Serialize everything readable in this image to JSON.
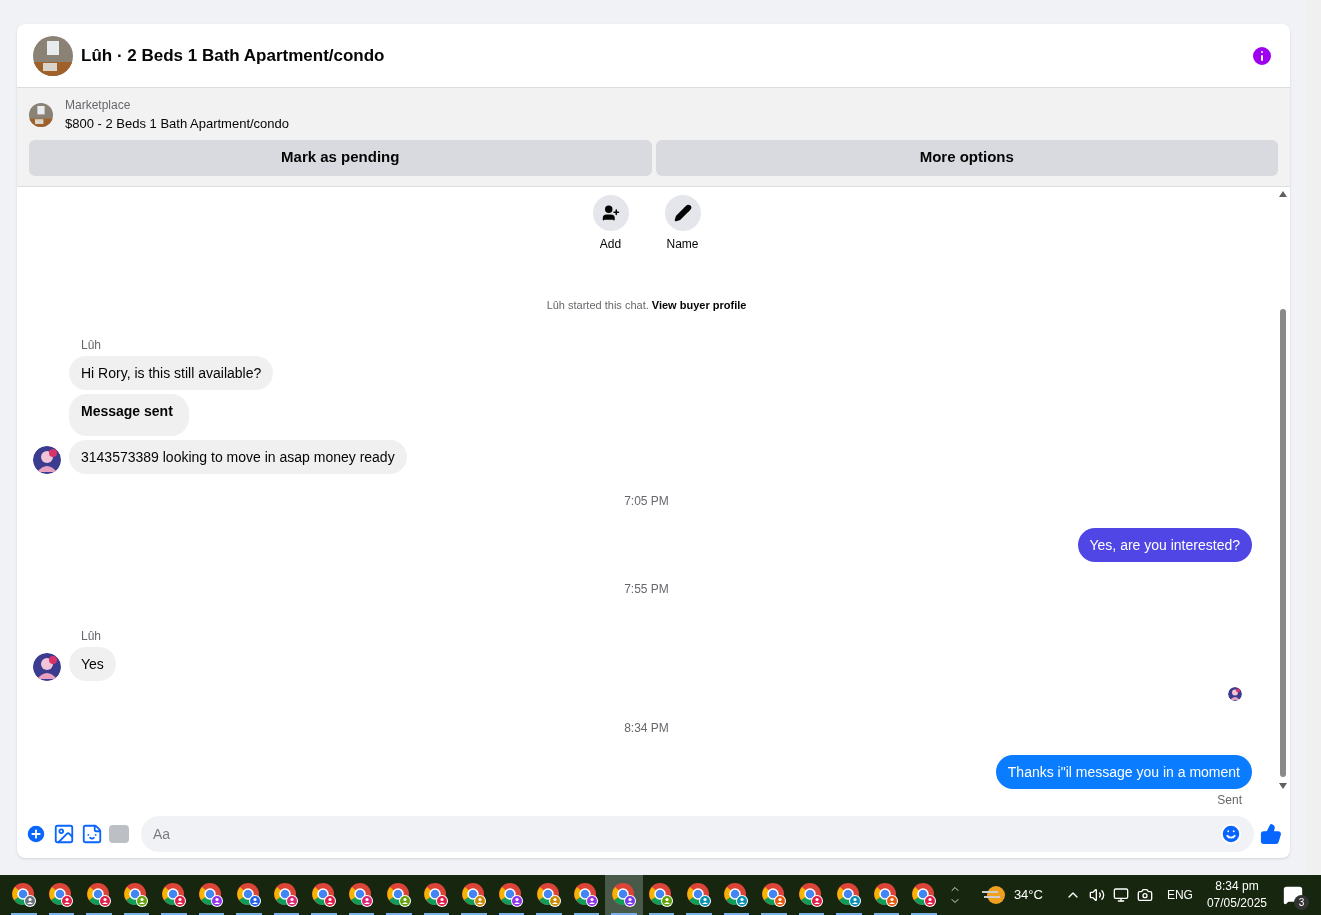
{
  "header": {
    "title": "Lûh · 2 Beds 1 Bath Apartment/condo"
  },
  "listing": {
    "source": "Marketplace",
    "title": "$800 - 2 Beds 1 Bath Apartment/condo",
    "buttons": [
      "Mark as pending",
      "More options"
    ]
  },
  "actions": [
    {
      "kind": "add",
      "label": "Add"
    },
    {
      "kind": "name",
      "label": "Name"
    }
  ],
  "system_note": {
    "text": "Lûh started this chat.",
    "link": "View buyer profile"
  },
  "messages": [
    {
      "kind": "sender",
      "text": "Lûh"
    },
    {
      "kind": "incoming",
      "text": "Hi Rory, is this still available?",
      "avatar": false,
      "bold": false
    },
    {
      "kind": "incoming",
      "text": "Message sent",
      "avatar": false,
      "bold": true
    },
    {
      "kind": "incoming",
      "text": "3143573389 looking to move in asap money ready",
      "avatar": true,
      "bold": false
    },
    {
      "kind": "time",
      "text": "7:05 PM"
    },
    {
      "kind": "outgoing",
      "text": "Yes, are you interested?",
      "color": "#4f46e5"
    },
    {
      "kind": "time",
      "text": "7:55 PM"
    },
    {
      "kind": "sender",
      "text": "Lûh"
    },
    {
      "kind": "incoming",
      "text": "Yes",
      "avatar": true,
      "bold": false
    },
    {
      "kind": "seen"
    },
    {
      "kind": "time",
      "text": "8:34 PM"
    },
    {
      "kind": "outgoing",
      "text": "Thanks i\"il message you in a moment",
      "color": "#0a7cff"
    },
    {
      "kind": "status",
      "text": "Sent"
    }
  ],
  "composer": {
    "placeholder": "Aa"
  },
  "taskbar": {
    "apps": [
      {
        "color": "#6b7280",
        "selected": false
      },
      {
        "color": "#e11d48",
        "selected": false
      },
      {
        "color": "#e11d48",
        "selected": false
      },
      {
        "color": "#65a30d",
        "selected": false
      },
      {
        "color": "#e11d48",
        "selected": false
      },
      {
        "color": "#9333ea",
        "selected": false
      },
      {
        "color": "#2563eb",
        "selected": false
      },
      {
        "color": "#db2777",
        "selected": false
      },
      {
        "color": "#e11d48",
        "selected": false
      },
      {
        "color": "#db2777",
        "selected": false
      },
      {
        "color": "#65a30d",
        "selected": false
      },
      {
        "color": "#e11d48",
        "selected": false
      },
      {
        "color": "#ca8a04",
        "selected": false
      },
      {
        "color": "#9333ea",
        "selected": false
      },
      {
        "color": "#ca8a04",
        "selected": false
      },
      {
        "color": "#9333ea",
        "selected": false
      },
      {
        "color": "#7c3aed",
        "selected": true
      },
      {
        "color": "#65a30d",
        "selected": false
      },
      {
        "color": "#0891b2",
        "selected": false
      },
      {
        "color": "#0891b2",
        "selected": false
      },
      {
        "color": "#ea580c",
        "selected": false
      },
      {
        "color": "#e11d48",
        "selected": false
      },
      {
        "color": "#0891b2",
        "selected": false
      },
      {
        "color": "#ea580c",
        "selected": false
      },
      {
        "color": "#e11d48",
        "selected": false
      }
    ],
    "temperature": "34°C",
    "language": "ENG",
    "time": "8:34 pm",
    "date": "07/05/2025",
    "notifications": "3"
  }
}
